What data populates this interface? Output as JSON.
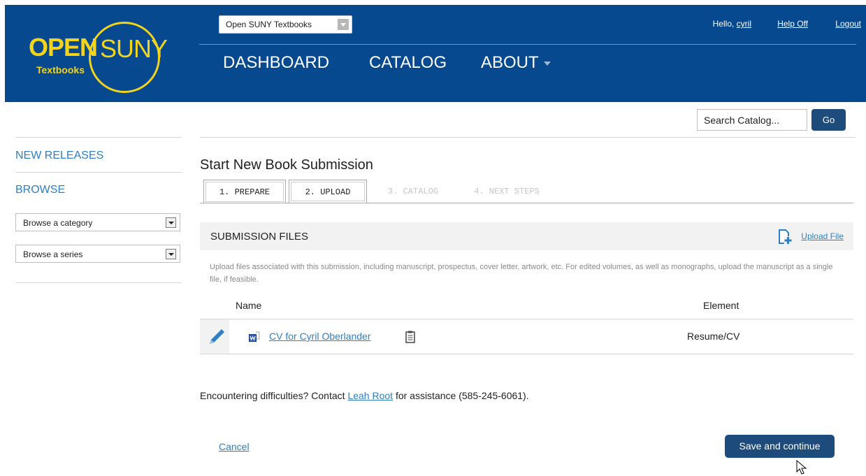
{
  "header": {
    "logo": {
      "open": "OPEN",
      "suny": "SUNY",
      "sub": "Textbooks"
    },
    "site_select": {
      "value": "Open SUNY Textbooks"
    },
    "user": {
      "hello_prefix": "Hello,",
      "username": "cyril",
      "help": "Help Off",
      "logout": "Logout"
    },
    "nav": [
      "DASHBOARD",
      "CATALOG",
      "ABOUT"
    ],
    "colors": {
      "bar": "#07498f",
      "logo": "#f4d31c"
    }
  },
  "search": {
    "placeholder": "Search Catalog...",
    "go_label": "Go"
  },
  "sidebar": {
    "new_releases": "NEW RELEASES",
    "browse": "BROWSE",
    "category_select": "Browse a category",
    "series_select": "Browse a series"
  },
  "main": {
    "title": "Start New Book Submission",
    "tabs": [
      {
        "label": "1. PREPARE",
        "state": "done"
      },
      {
        "label": "2. UPLOAD",
        "state": "active"
      },
      {
        "label": "3. CATALOG",
        "state": "disabled"
      },
      {
        "label": "4. NEXT STEPS",
        "state": "disabled"
      }
    ],
    "files": {
      "heading": "SUBMISSION FILES",
      "upload_label": "Upload File",
      "help": "Upload files associated with this submission, including manuscript, prospectus, cover letter, artwork, etc. For edited volumes, as well as monographs, upload the manuscript as a single file, if feasible.",
      "columns": {
        "name": "Name",
        "element": "Element"
      },
      "rows": [
        {
          "name": "CV for Cyril Oberlander",
          "element": "Resume/CV"
        }
      ]
    },
    "contact": {
      "prefix": "Encountering difficulties? Contact",
      "person": "Leah Root",
      "suffix": "for assistance (585-245-6061)."
    },
    "cancel_label": "Cancel",
    "save_label": "Save and continue"
  },
  "icons": {
    "edit": "pencil-icon",
    "file": "word-document-icon",
    "notes": "clipboard-icon",
    "upload": "file-add-icon"
  }
}
